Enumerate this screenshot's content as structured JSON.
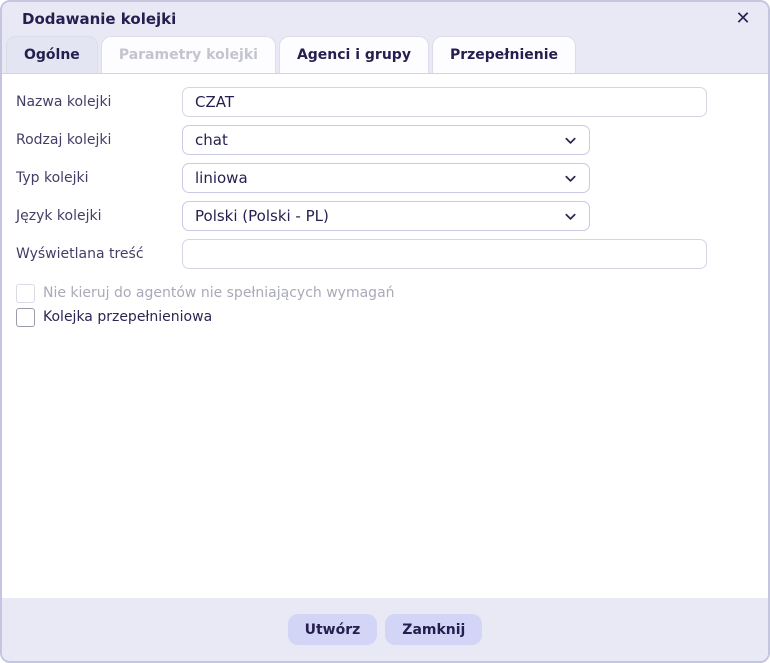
{
  "window": {
    "title": "Dodawanie kolejki"
  },
  "icons": {
    "close": "✕",
    "chevron_down": "chevron-down"
  },
  "tabs": [
    {
      "label": "Ogólne",
      "state": "active"
    },
    {
      "label": "Parametry kolejki",
      "state": "disabled"
    },
    {
      "label": "Agenci i grupy",
      "state": "normal"
    },
    {
      "label": "Przepełnienie",
      "state": "normal"
    }
  ],
  "form": {
    "fields": [
      {
        "label": "Nazwa kolejki",
        "type": "text",
        "value": "CZAT"
      },
      {
        "label": "Rodzaj kolejki",
        "type": "select",
        "value": "chat"
      },
      {
        "label": "Typ kolejki",
        "type": "select",
        "value": "liniowa"
      },
      {
        "label": "Język kolejki",
        "type": "select",
        "value": "Polski (Polski - PL)"
      },
      {
        "label": "Wyświetlana treść",
        "type": "text",
        "value": ""
      }
    ],
    "checkboxes": [
      {
        "label": "Nie kieruj do agentów nie spełniających wymagań",
        "checked": false,
        "disabled": true
      },
      {
        "label": "Kolejka przepełnieniowa",
        "checked": false,
        "disabled": false
      }
    ]
  },
  "footer": {
    "buttons": [
      {
        "label": "Utwórz"
      },
      {
        "label": "Zamknij"
      }
    ]
  },
  "colors": {
    "accent_bg": "#e9e9f6",
    "active_tab_bg": "#e4e5f3",
    "button_bg": "#d3d5f7",
    "text_dark": "#241f4e",
    "text_label": "#433e68",
    "text_disabled": "#c4c4d0",
    "dialog_border": "#c4c6df",
    "input_border": "#d5d6e2"
  }
}
